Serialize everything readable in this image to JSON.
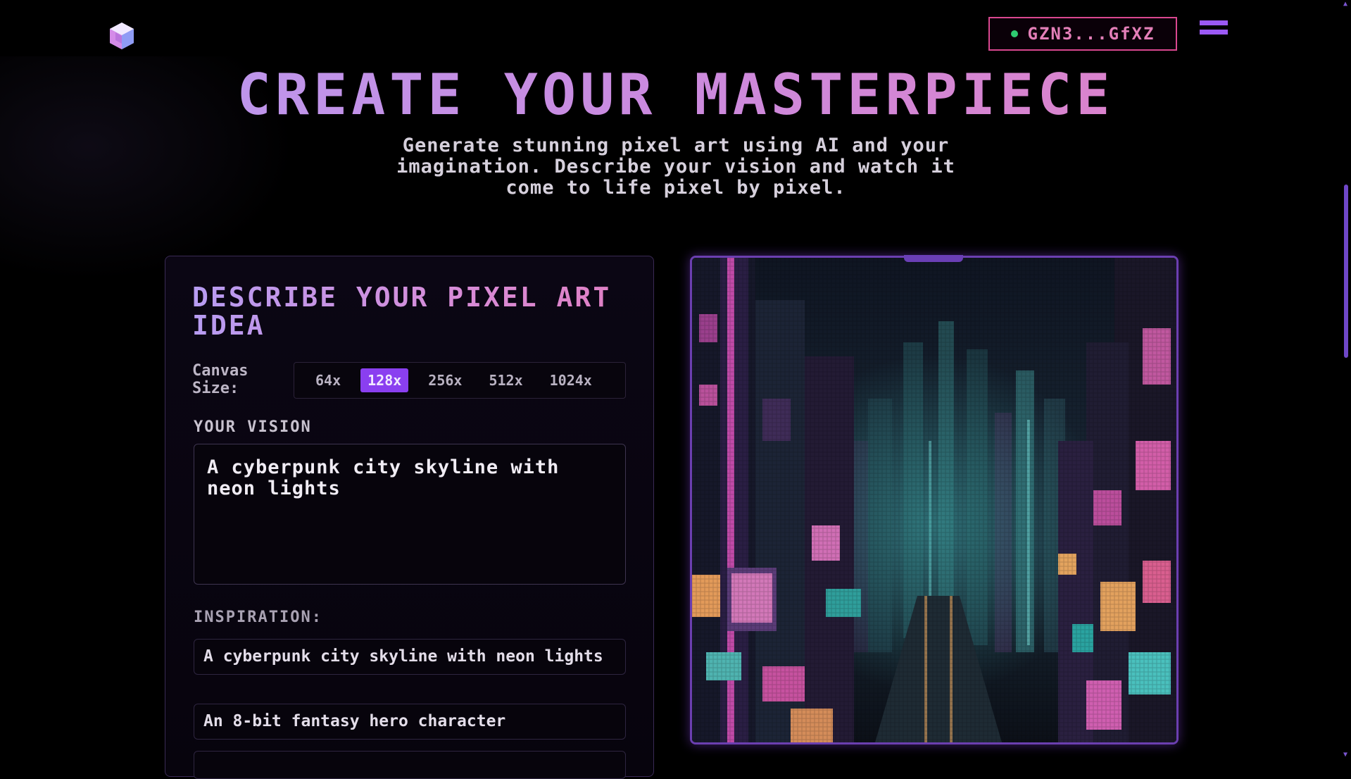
{
  "header": {
    "logo_icon": "cube-logo-icon",
    "wallet": {
      "status_color": "#2ecc71",
      "address": "GZN3...GfXZ"
    },
    "menu_icon": "hamburger-menu-icon"
  },
  "hero": {
    "title": "CREATE YOUR MASTERPIECE",
    "subtitle": "Generate stunning pixel art using AI and your imagination. Describe your vision and watch it come to life pixel by pixel."
  },
  "form": {
    "title": "DESCRIBE YOUR PIXEL ART IDEA",
    "canvas_label": "Canvas Size:",
    "sizes": [
      "64x",
      "128x",
      "256x",
      "512x",
      "1024x"
    ],
    "selected_size": "128x",
    "vision_label": "YOUR VISION",
    "vision_value": "A cyberpunk city skyline with neon lights",
    "inspiration_label": "INSPIRATION:",
    "inspirations": [
      "A cyberpunk city skyline with neon lights",
      "An 8-bit fantasy hero character"
    ]
  },
  "preview": {
    "image_name": "cyberpunk-city-pixel-art-image"
  },
  "colors": {
    "accent": "#8a3ff0",
    "pink": "#d9478f",
    "purple_border": "#6b3fb0"
  }
}
